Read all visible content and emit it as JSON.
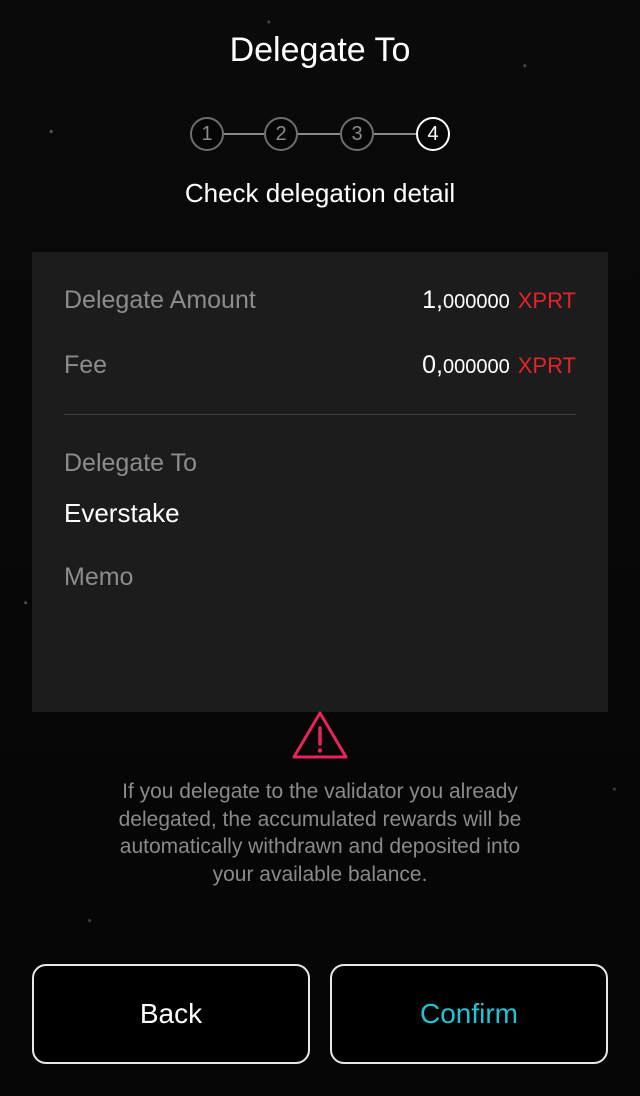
{
  "header": {
    "title": "Delegate To",
    "subtitle": "Check delegation detail"
  },
  "stepper": {
    "steps": [
      "1",
      "2",
      "3",
      "4"
    ],
    "current_step": 4
  },
  "details": {
    "amount_label": "Delegate Amount",
    "amount_int": "1,",
    "amount_dec": "000000",
    "amount_unit": "XPRT",
    "fee_label": "Fee",
    "fee_int": "0,",
    "fee_dec": "000000",
    "fee_unit": "XPRT",
    "delegate_to_label": "Delegate To",
    "validator_name": "Everstake",
    "memo_label": "Memo",
    "memo_value": ""
  },
  "warning": {
    "icon": "warning-triangle-icon",
    "color": "#e8245c",
    "text": "If you delegate to the validator you already delegated, the accumulated rewards will be automatically withdrawn and deposited into your available balance."
  },
  "buttons": {
    "back_label": "Back",
    "confirm_label": "Confirm"
  },
  "colors": {
    "accent": "#22c3d6",
    "unit": "#e3242b",
    "card": "#1c1c1c"
  }
}
